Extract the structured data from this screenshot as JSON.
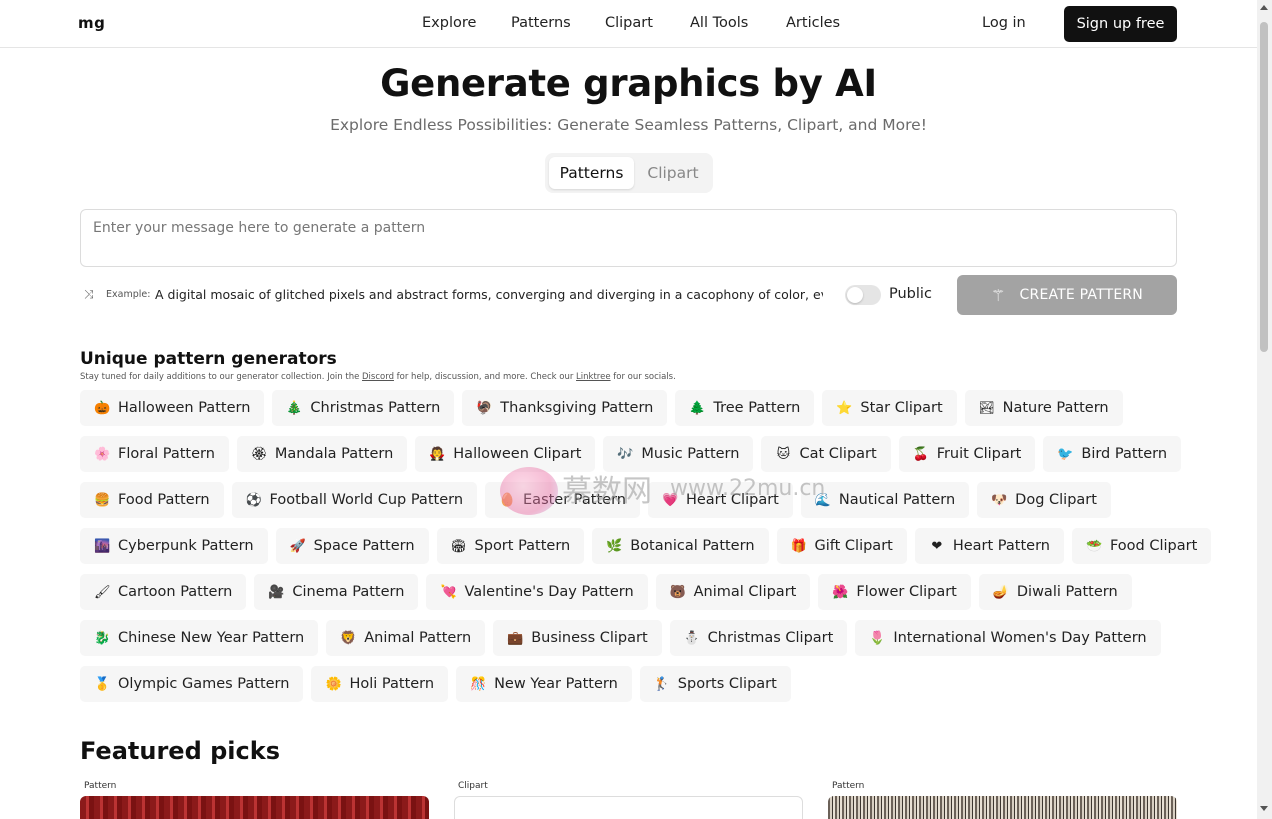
{
  "header": {
    "logo": "mg",
    "nav": [
      "Explore",
      "Patterns",
      "Clipart",
      "All Tools",
      "Articles"
    ],
    "login": "Log in",
    "signup": "Sign up free"
  },
  "hero": {
    "title": "Generate graphics by AI",
    "subtitle": "Explore Endless Possibilities: Generate Seamless Patterns, Clipart, and More!",
    "tabs": [
      "Patterns",
      "Clipart"
    ],
    "active_tab": "Patterns"
  },
  "prompt": {
    "placeholder": "Enter your message here to generate a pattern",
    "example_label": "Example:",
    "example_text": "A digital mosaic of glitched pixels and abstract forms, converging and diverging in a cacophony of color, evoking a s",
    "public_label": "Public",
    "public_enabled": false,
    "create_button": "CREATE PATTERN"
  },
  "generators": {
    "title": "Unique pattern generators",
    "subtitle_before": "Stay tuned for daily additions to our generator collection. Join the ",
    "discord": "Discord",
    "subtitle_middle": " for help, discussion, and more. Check our ",
    "linktree": "Linktree",
    "subtitle_after": " for our socials.",
    "rows": [
      [
        {
          "emoji": "🎃",
          "label": "Halloween Pattern"
        },
        {
          "emoji": "🎄",
          "label": "Christmas Pattern"
        },
        {
          "emoji": "🦃",
          "label": "Thanksgiving Pattern"
        },
        {
          "emoji": "🌲",
          "label": "Tree Pattern"
        },
        {
          "emoji": "⭐",
          "label": "Star Clipart"
        },
        {
          "emoji": "🏞",
          "label": "Nature Pattern"
        }
      ],
      [
        {
          "emoji": "🌸",
          "label": "Floral Pattern"
        },
        {
          "emoji": "🏵",
          "label": "Mandala Pattern"
        },
        {
          "emoji": "🧛",
          "label": "Halloween Clipart"
        },
        {
          "emoji": "🎶",
          "label": "Music Pattern"
        },
        {
          "emoji": "🐱",
          "label": "Cat Clipart"
        },
        {
          "emoji": "🍒",
          "label": "Fruit Clipart"
        },
        {
          "emoji": "🐦",
          "label": "Bird Pattern"
        }
      ],
      [
        {
          "emoji": "🍔",
          "label": "Food Pattern"
        },
        {
          "emoji": "⚽",
          "label": "Football World Cup Pattern"
        },
        {
          "emoji": "🥚",
          "label": "Easter Pattern"
        },
        {
          "emoji": "💗",
          "label": "Heart Clipart"
        },
        {
          "emoji": "🌊",
          "label": "Nautical Pattern"
        },
        {
          "emoji": "🐶",
          "label": "Dog Clipart"
        }
      ],
      [
        {
          "emoji": "🌆",
          "label": "Cyberpunk Pattern"
        },
        {
          "emoji": "🚀",
          "label": "Space Pattern"
        },
        {
          "emoji": "🏟",
          "label": "Sport Pattern"
        },
        {
          "emoji": "🌿",
          "label": "Botanical Pattern"
        },
        {
          "emoji": "🎁",
          "label": "Gift Clipart"
        },
        {
          "emoji": "❤",
          "label": "Heart Pattern"
        },
        {
          "emoji": "🥗",
          "label": "Food Clipart"
        }
      ],
      [
        {
          "emoji": "🖌",
          "label": "Cartoon Pattern"
        },
        {
          "emoji": "🎥",
          "label": "Cinema Pattern"
        },
        {
          "emoji": "💘",
          "label": "Valentine's Day Pattern"
        },
        {
          "emoji": "🐻",
          "label": "Animal Clipart"
        },
        {
          "emoji": "🌺",
          "label": "Flower Clipart"
        },
        {
          "emoji": "🪔",
          "label": "Diwali Pattern"
        }
      ],
      [
        {
          "emoji": "🐉",
          "label": "Chinese New Year Pattern"
        },
        {
          "emoji": "🦁",
          "label": "Animal Pattern"
        },
        {
          "emoji": "💼",
          "label": "Business Clipart"
        },
        {
          "emoji": "⛄",
          "label": "Christmas Clipart"
        },
        {
          "emoji": "🌷",
          "label": "International Women's Day Pattern"
        }
      ],
      [
        {
          "emoji": "🥇",
          "label": "Olympic Games Pattern"
        },
        {
          "emoji": "🌼",
          "label": "Holi Pattern"
        },
        {
          "emoji": "🎊",
          "label": "New Year Pattern"
        },
        {
          "emoji": "🏌",
          "label": "Sports Clipart"
        }
      ]
    ]
  },
  "featured": {
    "title": "Featured picks",
    "cards": [
      {
        "label": "Pattern"
      },
      {
        "label": "Clipart"
      },
      {
        "label": "Pattern"
      }
    ]
  },
  "watermark": {
    "text": "慕数网",
    "url": "www.22mu.cn"
  }
}
